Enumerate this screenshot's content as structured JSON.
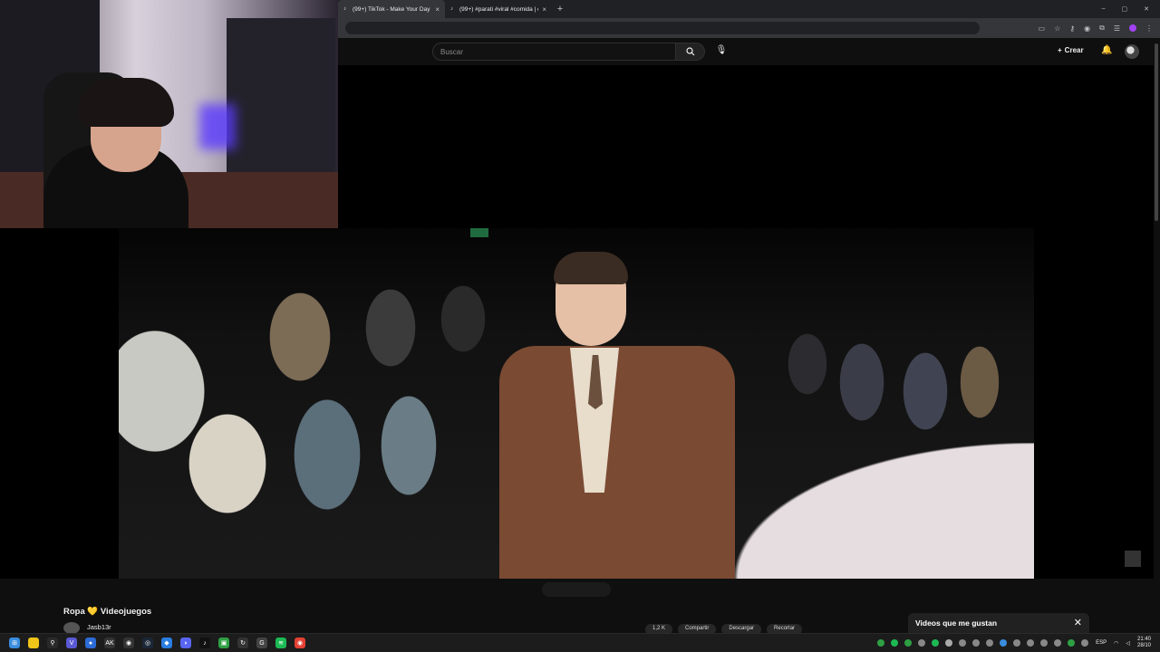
{
  "browser": {
    "tabs": [
      {
        "title": "(99+) TikTok - Make Your Day",
        "active": true
      },
      {
        "title": "(99+) #parati #viral #comida | c",
        "active": false
      }
    ],
    "new_tab": "+",
    "window_controls": [
      "–",
      "▢",
      "✕"
    ]
  },
  "youtube": {
    "search_placeholder": "Buscar",
    "create_label": "Crear",
    "bell_icon": "🔔"
  },
  "video": {
    "title": "Ropa 💛 Videojuegos",
    "channel": "Jasb13r",
    "action_labels": [
      "1,2 K",
      "Compartir",
      "Descargar",
      "Recortar"
    ]
  },
  "popup": {
    "title": "Videos que me gustan",
    "close": "✕"
  },
  "taskbar": {
    "icons": [
      {
        "name": "windows-start-icon",
        "color": "#3a8dde",
        "glyph": "⊞"
      },
      {
        "name": "file-explorer-icon",
        "color": "#f0c419",
        "glyph": ""
      },
      {
        "name": "search-icon",
        "color": "#2a2a2a",
        "glyph": "⚲"
      },
      {
        "name": "app-v-icon",
        "color": "#5a5ad6",
        "glyph": "V"
      },
      {
        "name": "app-circle-icon",
        "color": "#2d6bd6",
        "glyph": "●"
      },
      {
        "name": "app-ak-icon",
        "color": "#333",
        "glyph": "AK"
      },
      {
        "name": "app-obs-icon",
        "color": "#333",
        "glyph": "◉"
      },
      {
        "name": "steam-icon",
        "color": "#1b2838",
        "glyph": "◎"
      },
      {
        "name": "app-blue-icon",
        "color": "#2a7de1",
        "glyph": "◆"
      },
      {
        "name": "discord-icon",
        "color": "#5865f2",
        "glyph": "◗"
      },
      {
        "name": "tiktok-icon",
        "color": "#111",
        "glyph": "♪"
      },
      {
        "name": "app-green-icon",
        "color": "#2ea043",
        "glyph": "▣"
      },
      {
        "name": "app-cycle-icon",
        "color": "#333",
        "glyph": "↻"
      },
      {
        "name": "app-g-icon",
        "color": "#444",
        "glyph": "G"
      },
      {
        "name": "spotify-icon",
        "color": "#1db954",
        "glyph": "≋"
      },
      {
        "name": "chrome-icon",
        "color": "#e34133",
        "glyph": "◉"
      }
    ],
    "tray_colors": [
      "#2ea043",
      "#1db954",
      "#2ea043",
      "#888",
      "#1db954",
      "#aaa",
      "#888",
      "#888",
      "#888",
      "#3a8dde",
      "#888",
      "#888",
      "#888",
      "#888",
      "#2ea043",
      "#888"
    ],
    "lang": "ESP",
    "time": "21:40",
    "date": "28/10"
  }
}
